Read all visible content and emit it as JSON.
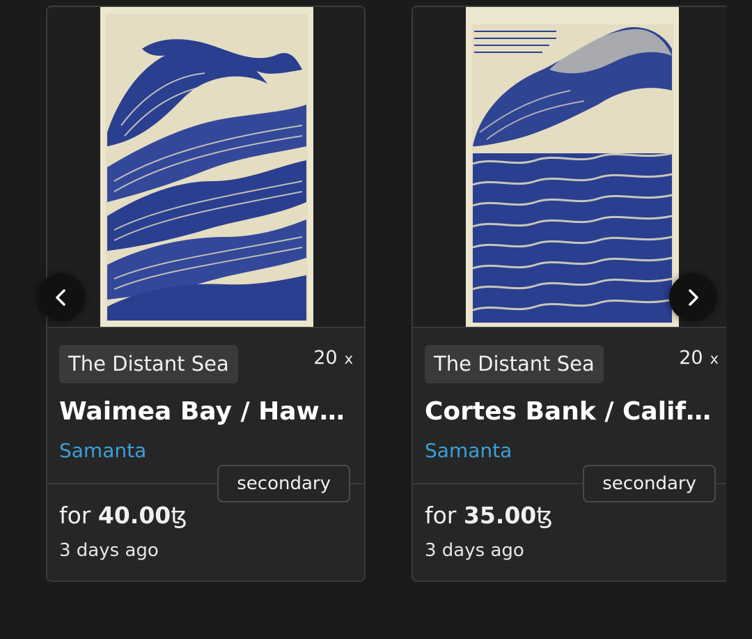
{
  "cards": [
    {
      "collection": "The Distant Sea",
      "edition_count": "20",
      "edition_suffix": "x",
      "title": "Waimea Bay / Hawaii",
      "artist": "Samanta",
      "badge": "secondary",
      "price_prefix": "for",
      "price_value": "40.00",
      "currency": "ꜩ",
      "time_ago": "3 days ago",
      "image_icon": "wave-artwork-image"
    },
    {
      "collection": "The Distant Sea",
      "edition_count": "20",
      "edition_suffix": "x",
      "title": "Cortes Bank / California",
      "artist": "Samanta",
      "badge": "secondary",
      "price_prefix": "for",
      "price_value": "35.00",
      "currency": "ꜩ",
      "time_ago": "3 days ago",
      "image_icon": "wave-artwork-image"
    }
  ],
  "navigation": {
    "prev_icon": "chevron-left-icon",
    "next_icon": "chevron-right-icon"
  },
  "colors": {
    "background": "#1b1b1b",
    "card": "#262626",
    "artist_link": "#3aa0d8",
    "art_ink": "#2a3f8f",
    "art_paper": "#ece6cf"
  }
}
